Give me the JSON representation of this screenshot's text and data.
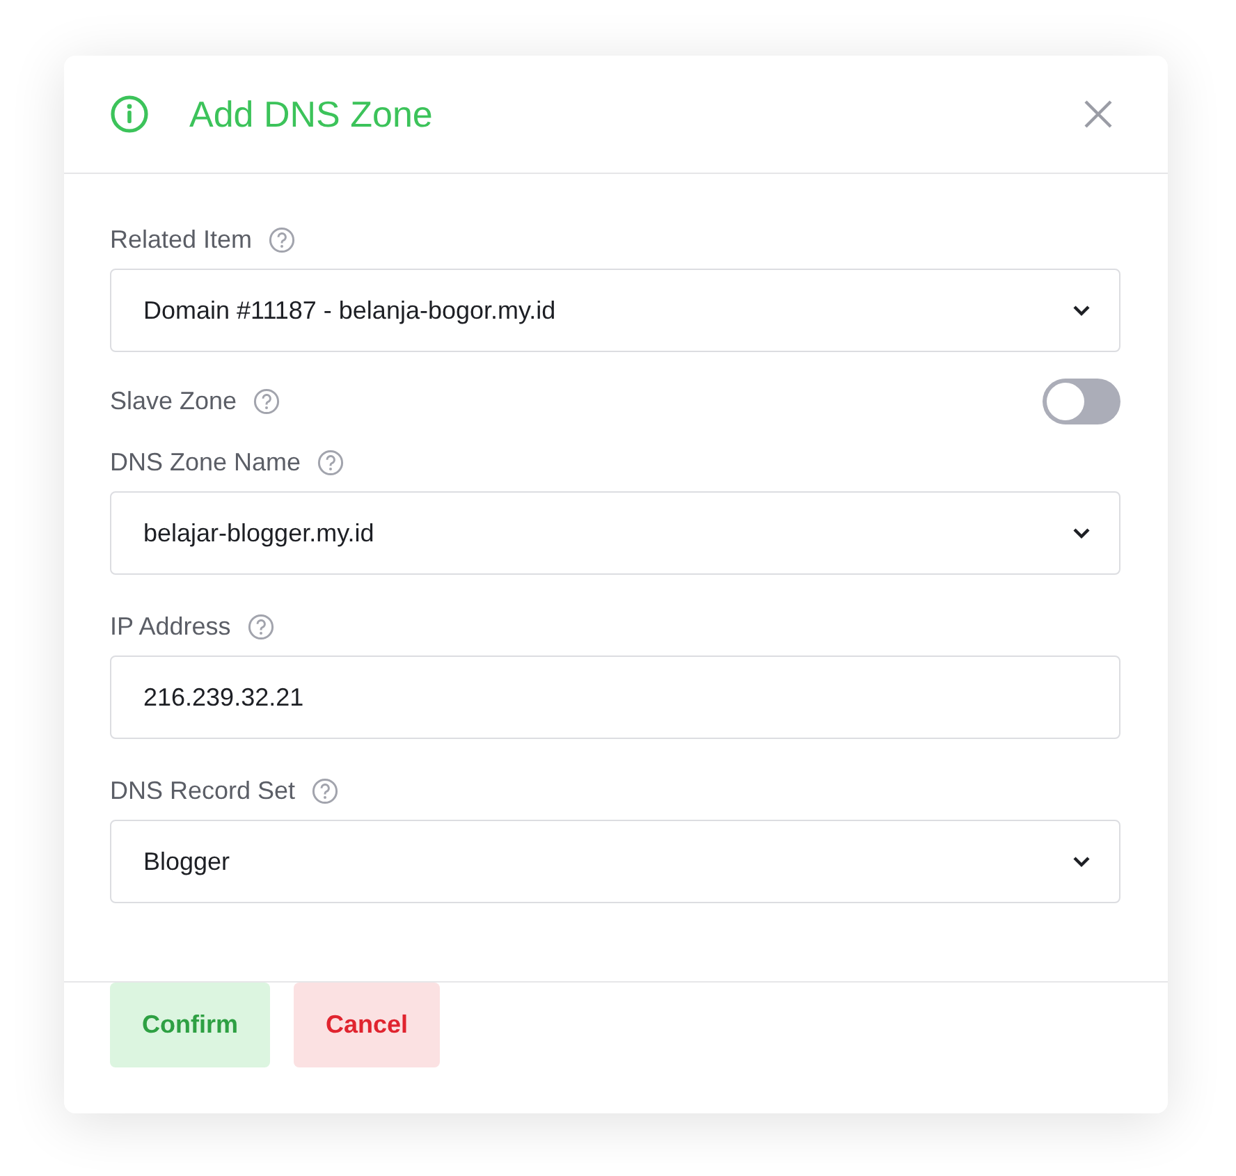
{
  "dialog": {
    "title": "Add DNS Zone"
  },
  "fields": [
    {
      "kind": "select",
      "label": "Related Item",
      "value": "Domain #11187 - belanja-bogor.my.id"
    },
    {
      "kind": "toggle",
      "label": "Slave Zone",
      "on": false
    },
    {
      "kind": "select",
      "label": "DNS Zone Name",
      "value": "belajar-blogger.my.id"
    },
    {
      "kind": "input",
      "label": "IP Address",
      "value": "216.239.32.21"
    },
    {
      "kind": "select",
      "label": "DNS Record Set",
      "value": "Blogger"
    }
  ],
  "buttons": [
    {
      "kind": "confirm",
      "label": "Confirm"
    },
    {
      "kind": "cancel",
      "label": "Cancel"
    }
  ]
}
